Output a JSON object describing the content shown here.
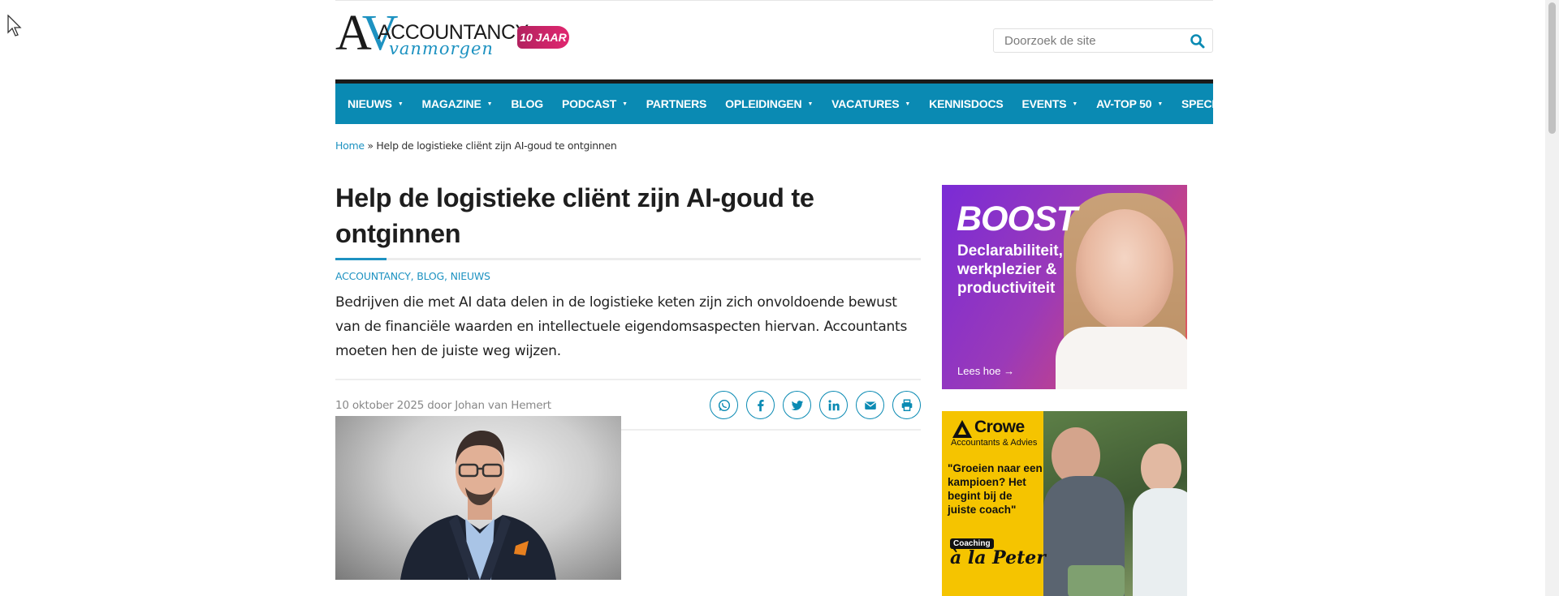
{
  "logo": {
    "av_a": "A",
    "av_v": "V",
    "wordmark": "ACCOUNTANCY",
    "script": "vanmorgen",
    "badge": "10 JAAR"
  },
  "search": {
    "placeholder": "Doorzoek de site"
  },
  "nav": {
    "items": [
      {
        "label": "NIEUWS",
        "caret": "▼"
      },
      {
        "label": "MAGAZINE",
        "caret": "▼"
      },
      {
        "label": "BLOG",
        "caret": ""
      },
      {
        "label": "PODCAST",
        "caret": "▼"
      },
      {
        "label": "PARTNERS",
        "caret": ""
      },
      {
        "label": "OPLEIDINGEN",
        "caret": "▼"
      },
      {
        "label": "VACATURES",
        "caret": "▼"
      },
      {
        "label": "KENNISDOCS",
        "caret": ""
      },
      {
        "label": "EVENTS",
        "caret": "▼"
      },
      {
        "label": "AV-TOP 50",
        "caret": "▼"
      },
      {
        "label": "SPECIALIST",
        "caret": ""
      }
    ]
  },
  "breadcrumb": {
    "home": "Home",
    "separator": " » ",
    "current": "Help de logistieke cliënt zijn AI-goud te ontginnen"
  },
  "article": {
    "title": "Help de logistieke cliënt zijn AI-goud te ontginnen",
    "categories": [
      "ACCOUNTANCY",
      "BLOG",
      "NIEUWS"
    ],
    "category_separator": ", ",
    "lead": "Bedrijven die met AI data delen in de logistieke keten zijn zich onvoldoende bewust van de financiële waarden en intellectuele eigendomsaspecten hiervan. Accountants moeten hen de juiste weg wijzen.",
    "date": "10 oktober 2025",
    "by": "door",
    "author": "Johan van Hemert",
    "share_icons": [
      "whatsapp-icon",
      "facebook-icon",
      "twitter-icon",
      "linkedin-icon",
      "email-icon",
      "print-icon"
    ]
  },
  "ad_boost": {
    "headline": "BOOST",
    "sub": "Declarabiliteit, werkplezier & productiviteit",
    "cta": "Lees hoe →"
  },
  "ad_crowe": {
    "brand": "Crowe",
    "tagline": "Accountants & Advies",
    "quote": "\"Groeien naar een kampioen? Het begint bij de juiste coach\"",
    "coach_tag": "Coaching",
    "coach": "à la Peter"
  },
  "colors": {
    "brand_blue": "#0a8ab3",
    "accent_blue": "#1d92c1",
    "badge_pink": "#e0266f",
    "crowe_yellow": "#f5c400"
  }
}
